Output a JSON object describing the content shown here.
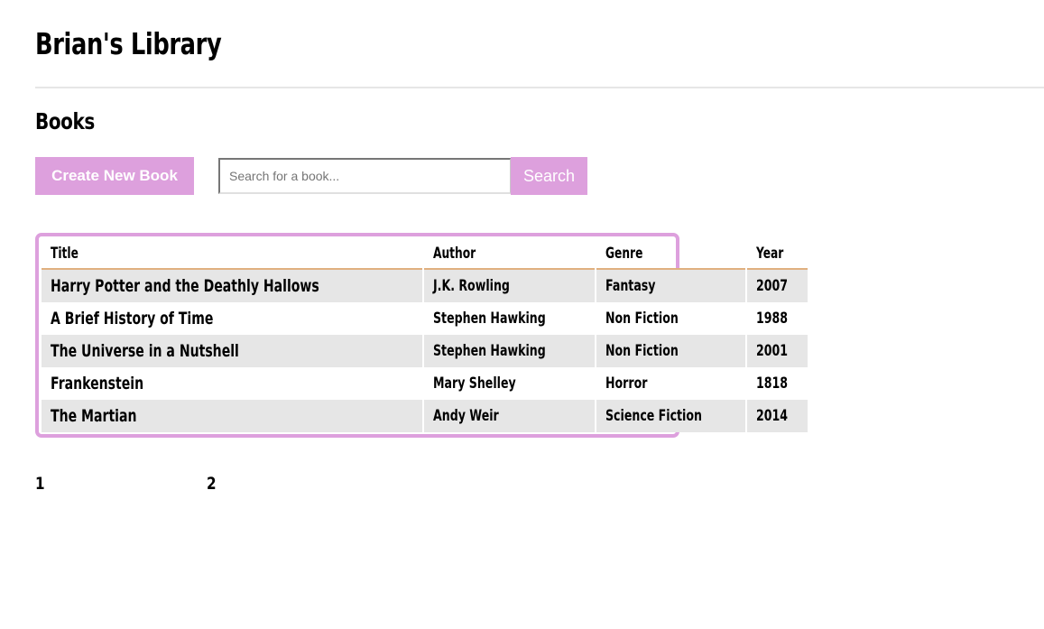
{
  "header": {
    "site_title": "Brian's Library"
  },
  "books_section": {
    "title": "Books",
    "create_button_label": "Create New Book",
    "search": {
      "placeholder": "Search for a book...",
      "value": "",
      "button_label": "Search"
    }
  },
  "table": {
    "columns": [
      "Title",
      "Author",
      "Genre",
      "Year"
    ],
    "rows": [
      [
        "Harry Potter and the Deathly Hallows",
        "J.K. Rowling",
        "Fantasy",
        "2007"
      ],
      [
        "A Brief History of Time",
        "Stephen Hawking",
        "Non Fiction",
        "1988"
      ],
      [
        "The Universe in a Nutshell",
        "Stephen Hawking",
        "Non Fiction",
        "2001"
      ],
      [
        "Frankenstein",
        "Mary Shelley",
        "Horror",
        "1818"
      ],
      [
        "The Martian",
        "Andy Weir",
        "Science Fiction",
        "2014"
      ]
    ]
  },
  "pagination": {
    "pages": [
      "1",
      "2"
    ]
  },
  "colors": {
    "accent": "#dda0dd",
    "row_stripe": "#e6e6e6",
    "header_rule": "#e0b080"
  }
}
